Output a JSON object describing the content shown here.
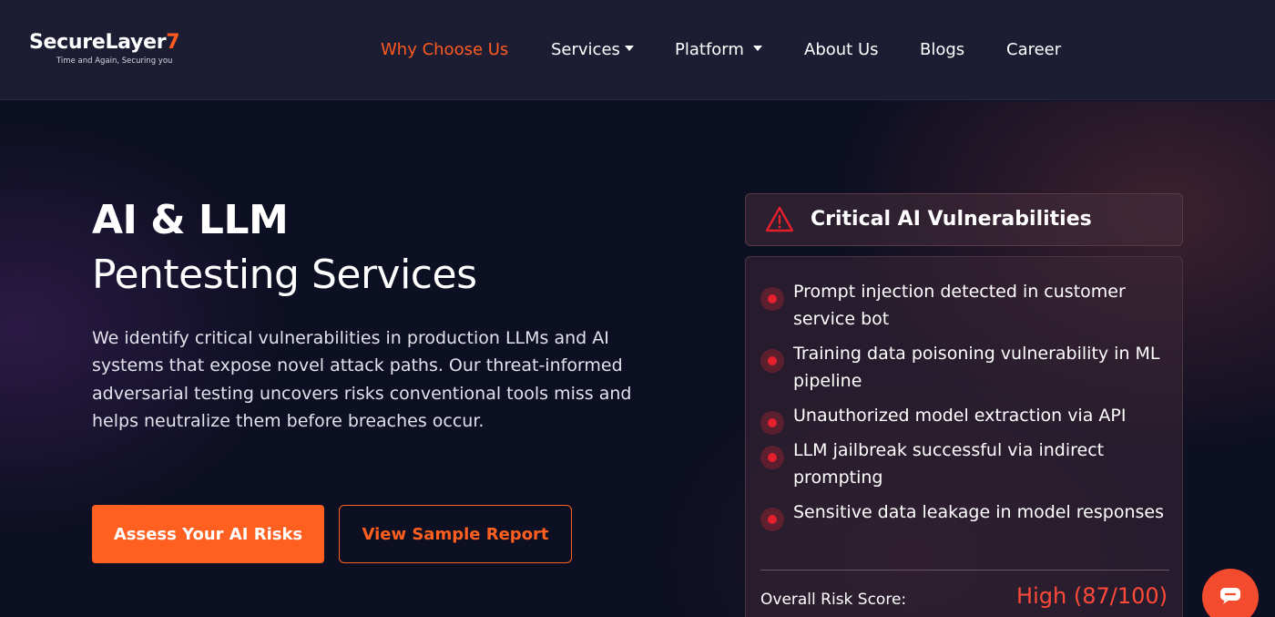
{
  "logo": {
    "name_main": "SecureLayer",
    "name_accent": "7",
    "tagline": "Time and Again, Securing you"
  },
  "nav": {
    "items": [
      {
        "label": "Why Choose Us",
        "active": true,
        "has_dropdown": false
      },
      {
        "label": "Services",
        "active": false,
        "has_dropdown": true
      },
      {
        "label": "Platform",
        "active": false,
        "has_dropdown": true
      },
      {
        "label": "About Us",
        "active": false,
        "has_dropdown": false
      },
      {
        "label": "Blogs",
        "active": false,
        "has_dropdown": false
      },
      {
        "label": "Career",
        "active": false,
        "has_dropdown": false
      }
    ]
  },
  "hero": {
    "title_bold": "AI & LLM",
    "title_light": "Pentesting Services",
    "description": "We identify critical vulnerabilities in production LLMs and AI systems that expose novel attack paths. Our threat-informed adversarial testing uncovers risks conventional tools miss and helps neutralize them before breaches occur.",
    "primary_button": "Assess Your AI Risks",
    "secondary_button": "View Sample Report"
  },
  "card": {
    "icon": "warning-triangle-icon",
    "title": "Critical AI Vulnerabilities",
    "vulnerabilities": [
      "Prompt injection detected in customer service bot",
      "Training data poisoning vulnerability in ML pipeline",
      "Unauthorized model extraction via API",
      "LLM jailbreak successful via indirect prompting",
      "Sensitive data leakage in model responses"
    ],
    "risk_label": "Overall Risk Score:",
    "risk_value": "High (87/100)"
  },
  "chat": {
    "icon": "chat-bubble-icon"
  },
  "colors": {
    "accent": "#ff5f1f",
    "danger": "#e3202c",
    "nav_bg": "#1c1c33",
    "page_bg": "#0d0f22"
  }
}
